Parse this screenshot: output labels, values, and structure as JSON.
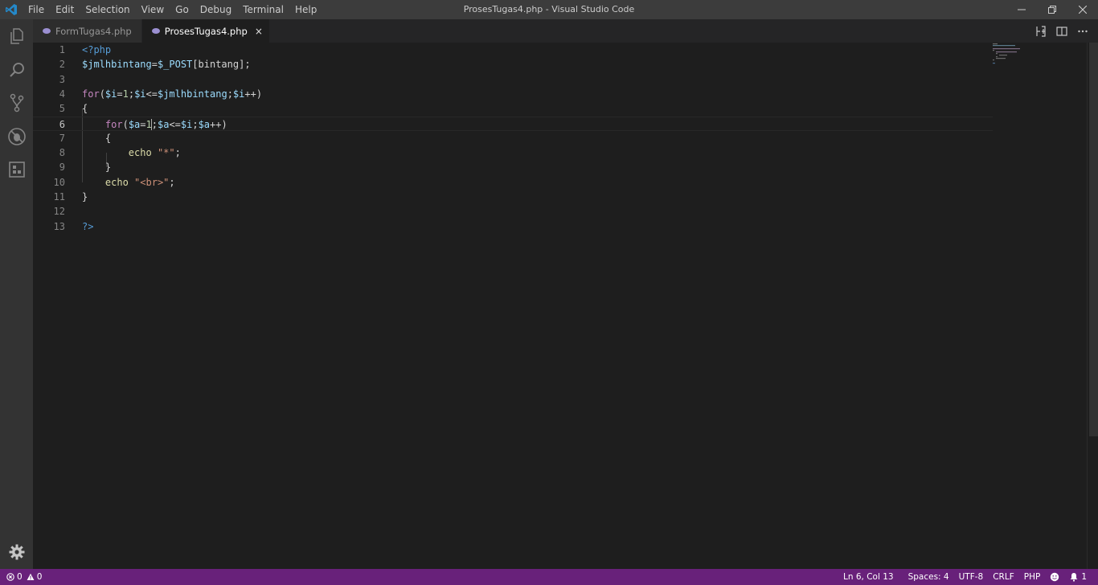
{
  "titlebar": {
    "title": "ProsesTugas4.php - Visual Studio Code",
    "menu": [
      "File",
      "Edit",
      "Selection",
      "View",
      "Go",
      "Debug",
      "Terminal",
      "Help"
    ]
  },
  "activity_bar": {
    "items": [
      "explorer-icon",
      "search-icon",
      "source-control-icon",
      "debug-icon",
      "extensions-icon"
    ],
    "bottom": "gear-icon"
  },
  "tabs": [
    {
      "label": "FormTugas4.php",
      "active": false
    },
    {
      "label": "ProsesTugas4.php",
      "active": true,
      "close": "×"
    }
  ],
  "editor": {
    "current_line": 6,
    "lines": [
      {
        "n": "1"
      },
      {
        "n": "2"
      },
      {
        "n": "3"
      },
      {
        "n": "4"
      },
      {
        "n": "5"
      },
      {
        "n": "6"
      },
      {
        "n": "7"
      },
      {
        "n": "8"
      },
      {
        "n": "9"
      },
      {
        "n": "10"
      },
      {
        "n": "11"
      },
      {
        "n": "12"
      },
      {
        "n": "13"
      }
    ],
    "tokens": {
      "l1": [
        "<?php"
      ],
      "l2": [
        "$jmlhbintang",
        "=",
        "$_POST",
        "[bintang];"
      ],
      "l4": [
        "for",
        "(",
        "$i",
        "=",
        "1",
        ";",
        "$i",
        "<=",
        "$jmlhbintang",
        ";",
        "$i",
        "++)"
      ],
      "l5": [
        "{"
      ],
      "l6": [
        "    ",
        "for",
        "(",
        "$a",
        "=",
        "1",
        ";",
        "$a",
        "<=",
        "$i",
        ";",
        "$a",
        "++)"
      ],
      "l7": [
        "    {"
      ],
      "l8": [
        "        ",
        "echo",
        " ",
        "\"*\"",
        ";"
      ],
      "l9": [
        "    }"
      ],
      "l10": [
        "    ",
        "echo",
        " ",
        "\"<br>\"",
        ";"
      ],
      "l11": [
        "}"
      ],
      "l13": [
        "?>"
      ]
    }
  },
  "status_bar": {
    "errors": "0",
    "warnings": "0",
    "position": "Ln 6, Col 13",
    "spaces": "Spaces: 4",
    "encoding": "UTF-8",
    "eol": "CRLF",
    "language": "PHP",
    "notifications": "1"
  },
  "colors": {
    "status_bar": "#68217a",
    "activity_bar": "#333333",
    "title_bar": "#3c3c3c",
    "editor_bg": "#1e1e1e",
    "keyword": "#c586c0",
    "variable": "#9cdcfe",
    "php_tag": "#569cd6",
    "number": "#b5cea8",
    "string": "#ce9178"
  }
}
